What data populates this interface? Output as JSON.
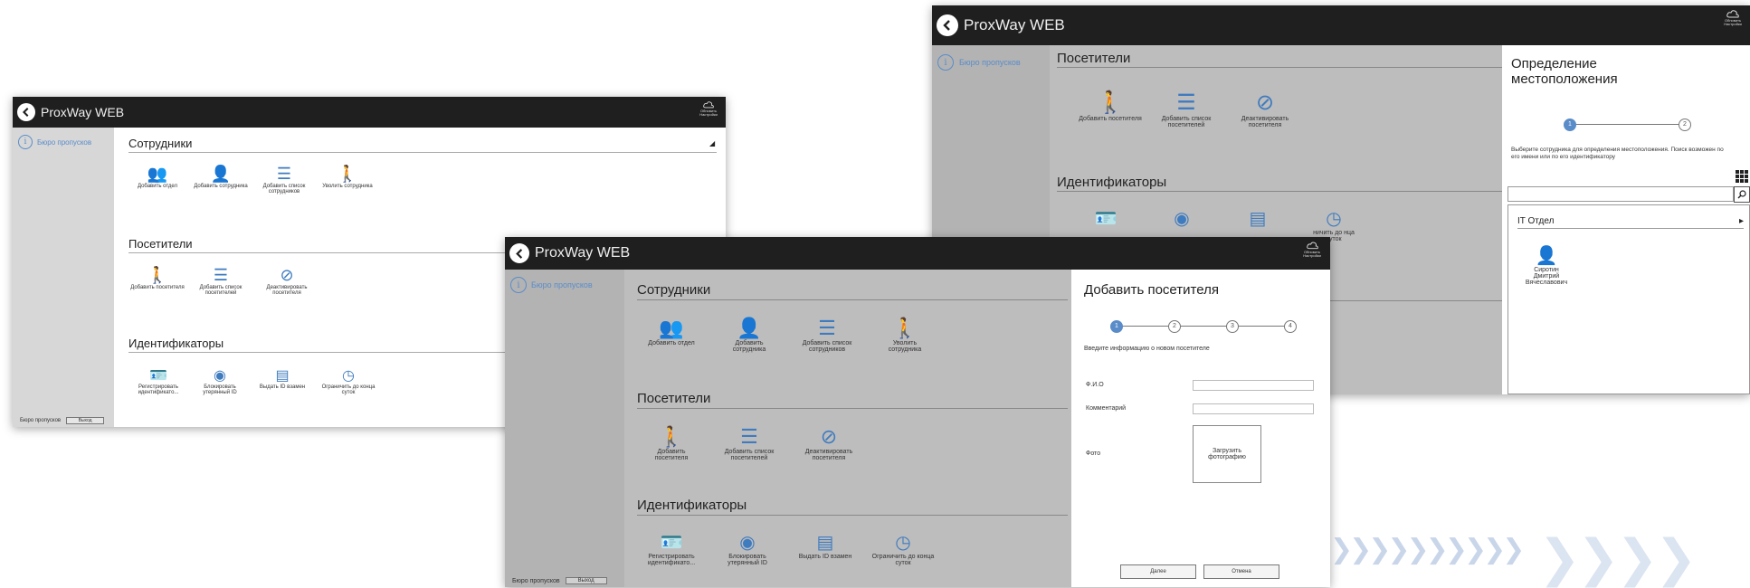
{
  "app": {
    "title": "ProxWay WEB",
    "update_label": "Обновить Настройки"
  },
  "nav": {
    "item": "Бюро пропусков",
    "footer_label": "Бюро пропусков",
    "logout": "Выход"
  },
  "sections": {
    "employees": {
      "title": "Сотрудники",
      "items": [
        {
          "icon": "department-icon",
          "label": "Добавить отдел"
        },
        {
          "icon": "add-employee-icon",
          "label": "Добавить сотрудника"
        },
        {
          "icon": "employee-list-icon",
          "label": "Добавить список сотрудников"
        },
        {
          "icon": "dismiss-employee-icon",
          "label": "Уволить сотрудника"
        }
      ]
    },
    "visitors": {
      "title": "Посетители",
      "items": [
        {
          "icon": "add-visitor-icon",
          "label": "Добавить посетителя"
        },
        {
          "icon": "visitor-list-icon",
          "label": "Добавить список посетителей"
        },
        {
          "icon": "deactivate-visitor-icon",
          "label": "Деактивировать посетителя"
        }
      ]
    },
    "identifiers": {
      "title": "Идентификаторы",
      "items": [
        {
          "icon": "register-id-icon",
          "label": "Регистрировать идентификато..."
        },
        {
          "icon": "block-id-icon",
          "label": "Блокировать утерянный ID"
        },
        {
          "icon": "issue-id-icon",
          "label": "Выдать ID взамен"
        },
        {
          "icon": "time-limit-icon",
          "label": "Ограничить до конца суток"
        }
      ],
      "partial_label": "ничить до нца суток"
    }
  },
  "add_visitor_panel": {
    "title": "Добавить посетителя",
    "steps": [
      "1",
      "2",
      "3",
      "4"
    ],
    "active_step": 1,
    "instruction": "Введите информацию о новом посетителе",
    "fields": {
      "name_label": "Ф.И.О",
      "name_value": "",
      "comment_label": "Комментарий",
      "comment_value": "",
      "photo_label": "Фото",
      "upload_label": "Загрузить фотографию"
    },
    "next_label": "Далее",
    "cancel_label": "Отмена"
  },
  "locate_panel": {
    "title": "Определение местоположения",
    "steps": [
      "1",
      "2"
    ],
    "active_step": 1,
    "instruction": "Выберите сотрудника для определения местоположения. Поиск возможен по его имени или по его идентификатору",
    "search_value": "",
    "group": "IT Отдел",
    "person": "Сиротин Дмитрий Вячеславович"
  },
  "colors": {
    "accent": "#3f7bbf",
    "titlebar": "#1f1f1f",
    "sidebar": "#c9c9c9",
    "dim": "#bdbdbd"
  }
}
